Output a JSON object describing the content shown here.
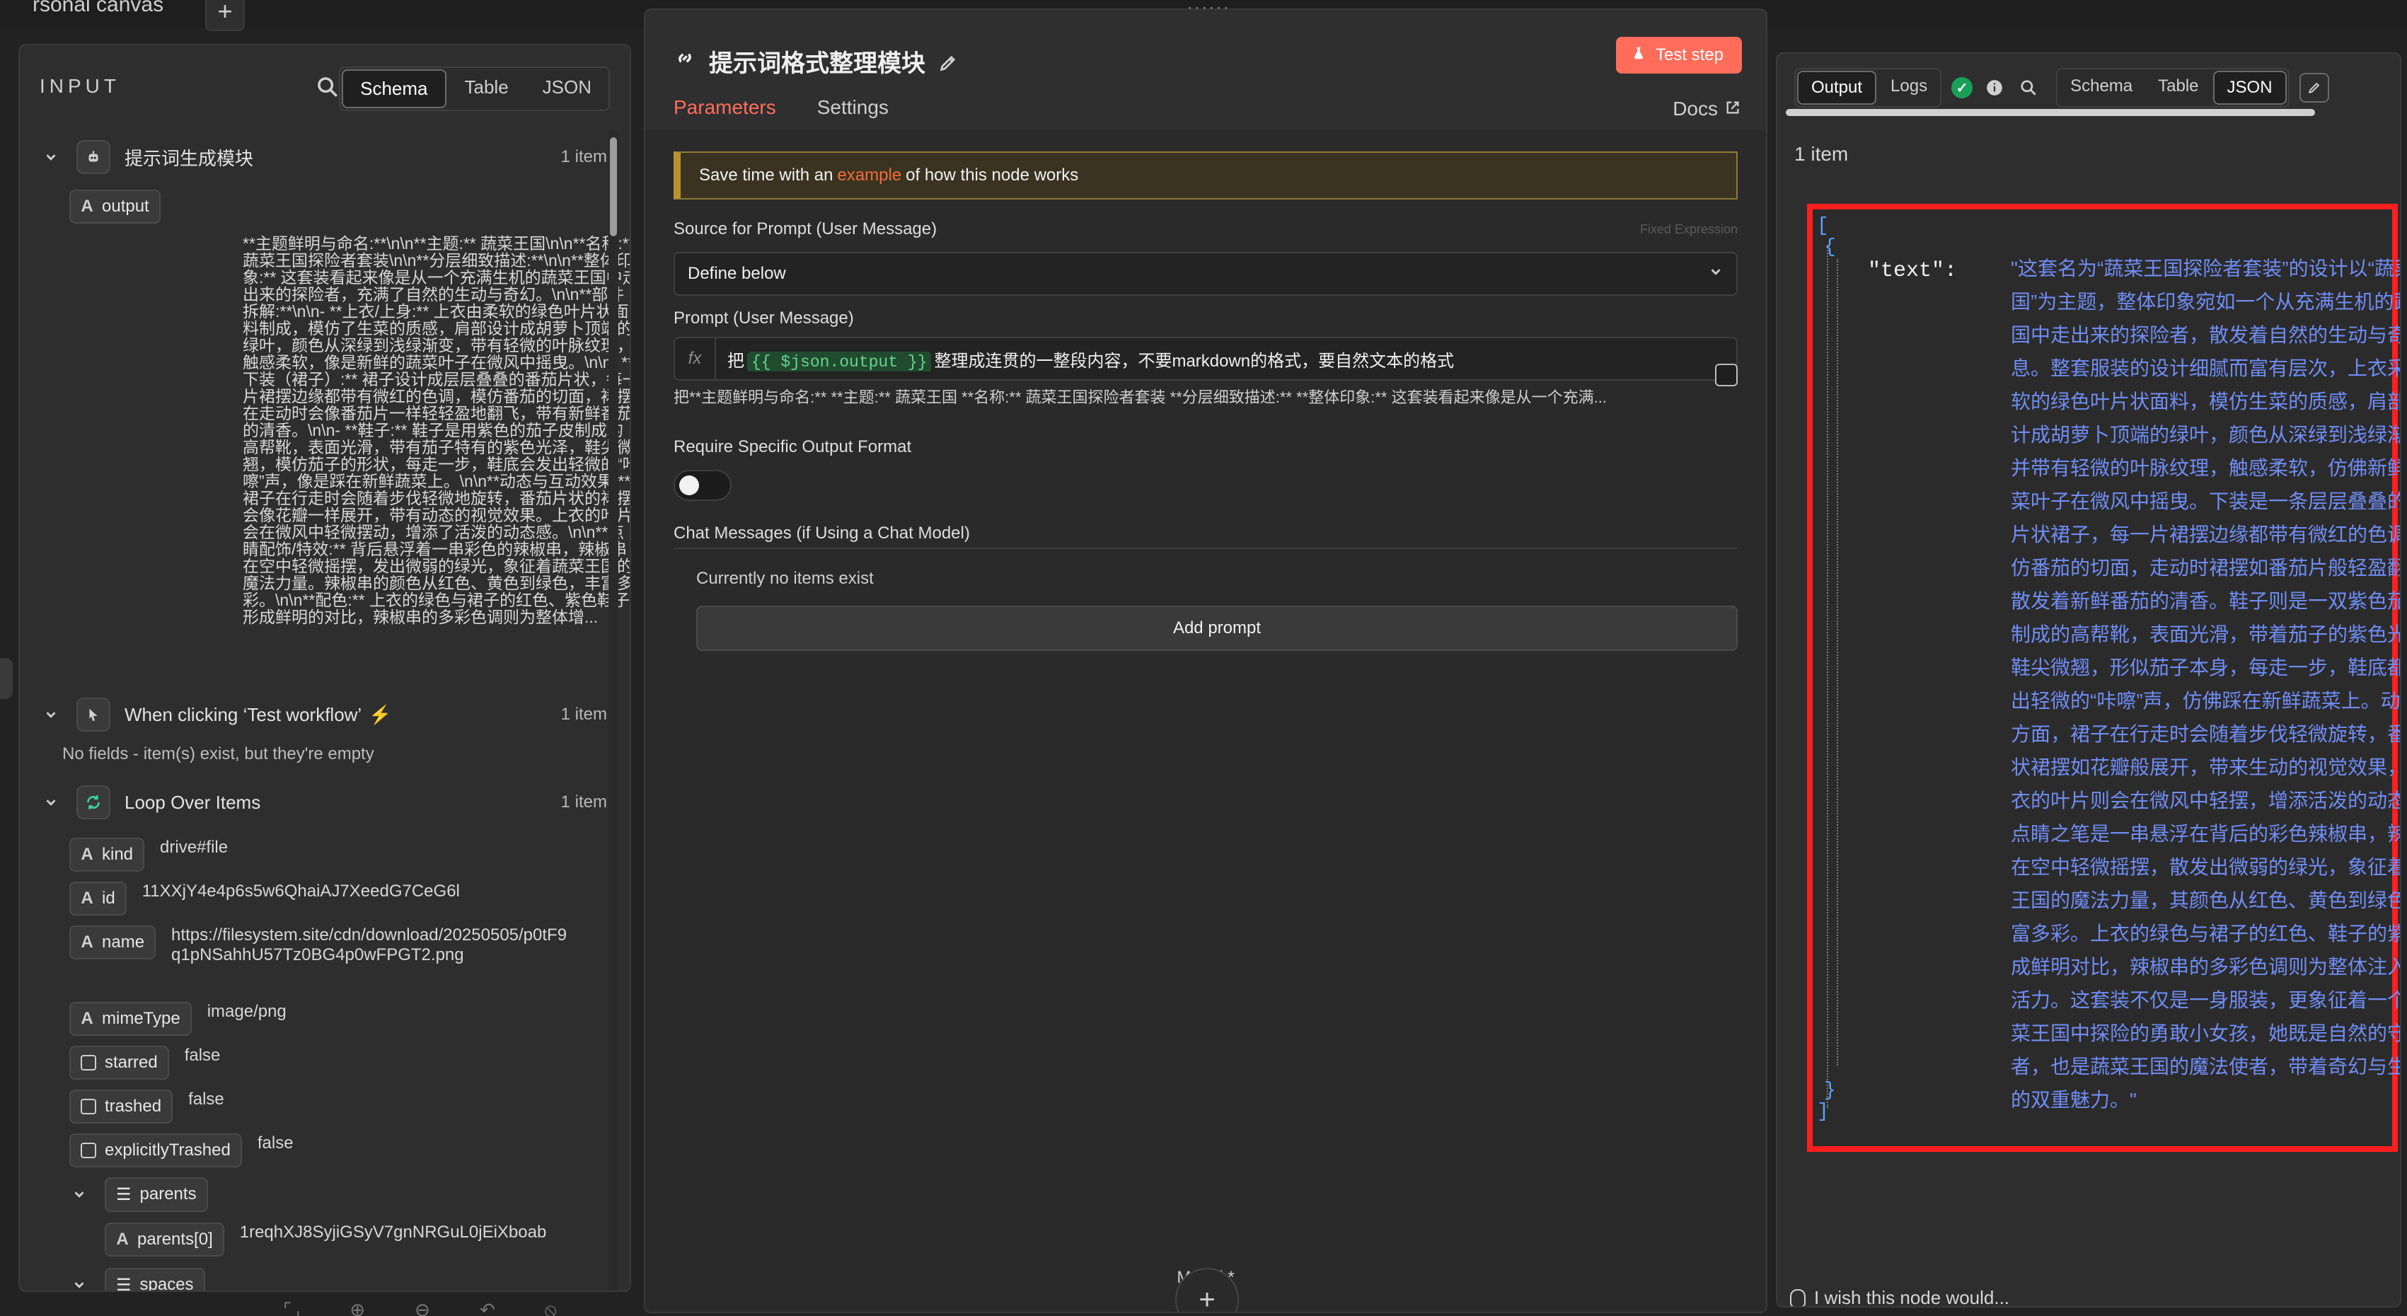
{
  "topbar": {
    "title": "rsonal canvas",
    "plus": "+",
    "grip": "::::::"
  },
  "input": {
    "header": "INPUT",
    "tabs": [
      "Schema",
      "Table",
      "JSON"
    ],
    "active_tab": "Schema",
    "nodes": [
      {
        "name": "提示词生成模块",
        "count": "1 item",
        "fields": [
          {
            "type": "A",
            "key": "output",
            "value": "**主题鲜明与命名:**\\n\\n**主题:** 蔬菜王国\\n\\n**名称:** 蔬菜王国探险者套装\\n\\n**分层细致描述:**\\n\\n**整体印象:** 这套装看起来像是从一个充满生机的蔬菜王国中走出来的探险者，充满了自然的生动与奇幻。\\n\\n**部件拆解:**\\n\\n- **上衣/上身:** 上衣由柔软的绿色叶片状面料制成，模仿了生菜的质感，肩部设计成胡萝卜顶端的绿叶，颜色从深绿到浅绿渐变，带有轻微的叶脉纹理，触感柔软，像是新鲜的蔬菜叶子在微风中摇曳。\\n\\n- **下装（裙子）:** 裙子设计成层层叠叠的番茄片状，每一片裙摆边缘都带有微红的色调，模仿番茄的切面，裙摆在走动时会像番茄片一样轻轻盈地翻飞，带有新鲜番茄的清香。\\n\\n- **鞋子:** 鞋子是用紫色的茄子皮制成的高帮靴，表面光滑，带有茄子特有的紫色光泽，鞋尖微翘，模仿茄子的形状，每走一步，鞋底会发出轻微的“咔嚓”声，像是踩在新鲜蔬菜上。\\n\\n**动态与互动效果:** 裙子在行走时会随着步伐轻微地旋转，番茄片状的裙摆会像花瓣一样展开，带有动态的视觉效果。上衣的叶片会在微风中轻微摆动，增添了活泼的动态感。\\n\\n**点睛配饰/特效:** 背后悬浮着一串彩色的辣椒串，辣椒串在空中轻微摇摆，发出微弱的绿光，象征着蔬菜王国的魔法力量。辣椒串的颜色从红色、黄色到绿色，丰富多彩。\\n\\n**配色:** 上衣的绿色与裙子的红色、紫色鞋子形成鲜明的对比，辣椒串的多彩色调则为整体增..."
          }
        ]
      },
      {
        "name": "When clicking ‘Test workflow’",
        "count": "1 item",
        "note": "No fields - item(s) exist, but they're empty"
      },
      {
        "name": "Loop Over Items",
        "count": "1 item",
        "fields": [
          {
            "type": "A",
            "key": "kind",
            "value": "drive#file"
          },
          {
            "type": "A",
            "key": "id",
            "value": "11XXjY4e4p6s5w6QhaiAJ7XeedG7CeG6l"
          },
          {
            "type": "A",
            "key": "name",
            "value": "https://filesystem.site/cdn/download/20250505/p0tF9q1pNSahhU57Tz0BG4p0wFPGT2.png"
          },
          {
            "type": "A",
            "key": "mimeType",
            "value": "image/png"
          },
          {
            "type": "bool",
            "key": "starred",
            "value": "false"
          },
          {
            "type": "bool",
            "key": "trashed",
            "value": "false"
          },
          {
            "type": "bool",
            "key": "explicitlyTrashed",
            "value": "false"
          },
          {
            "type": "list",
            "key": "parents",
            "value": ""
          },
          {
            "type": "A",
            "key": "parents[0]",
            "value": "1reqhXJ8SyjiGSyV7gnNRGuL0jEiXboab"
          },
          {
            "type": "list",
            "key": "spaces",
            "value": ""
          }
        ]
      }
    ]
  },
  "center": {
    "title": "提示词格式整理模块",
    "test_step": "Test step",
    "tabs": [
      "Parameters",
      "Settings"
    ],
    "active_tab": "Parameters",
    "docs": "Docs",
    "banner": {
      "prefix": "Save time with an",
      "link": "example",
      "suffix": "of how this node works"
    },
    "source_label": "Source for Prompt (User Message)",
    "source_value": "Define below",
    "fixed_expression": "Fixed  Expression",
    "prompt_label": "Prompt (User Message)",
    "prompt_value_prefix": "把",
    "prompt_expr": "{{ $json.output }}",
    "prompt_value_suffix": "整理成连贯的一整段内容，不要markdown的格式，要自然文本的格式",
    "prompt_preview": "把**主题鲜明与命名:** **主题:** 蔬菜王国 **名称:** 蔬菜王国探险者套装 **分层细致描述:** **整体印象:** 这套装看起来像是从一个充满...",
    "require_label": "Require Specific Output Format",
    "chat_label": "Chat Messages (if Using a Chat Model)",
    "no_items": "Currently no items exist",
    "add_prompt": "Add prompt",
    "model_label": "Model *"
  },
  "output": {
    "tabs": [
      "Output",
      "Logs"
    ],
    "active_tab": "Output",
    "view_tabs": [
      "Schema",
      "Table",
      "JSON"
    ],
    "active_view": "JSON",
    "items": "1 item",
    "json_key": "\"text\":",
    "json_text": "\"这套名为“蔬菜王国探险者套装”的设计以“蔬菜王国”为主题，整体印象宛如一个从充满生机的蔬菜王国中走出来的探险者，散发着自然的生动与奇幻气息。整套服装的设计细腻而富有层次，上衣采用柔软的绿色叶片状面料，模仿生菜的质感，肩部则设计成胡萝卜顶端的绿叶，颜色从深绿到浅绿渐变，并带有轻微的叶脉纹理，触感柔软，仿佛新鲜的蔬菜叶子在微风中摇曳。下装是一条层层叠叠的番茄片状裙子，每一片裙摆边缘都带有微红的色调，模仿番茄的切面，走动时裙摆如番茄片般轻盈翻飞，散发着新鲜番茄的清香。鞋子则是一双紫色茄子皮制成的高帮靴，表面光滑，带着茄子的紫色光泽，鞋尖微翘，形似茄子本身，每走一步，鞋底都会发出轻微的“咔嚓”声，仿佛踩在新鲜蔬菜上。动态效果方面，裙子在行走时会随着步伐轻微旋转，番茄片状裙摆如花瓣般展开，带来生动的视觉效果，而上衣的叶片则会在微风中轻摆，增添活泼的动态感。点睛之笔是一串悬浮在背后的彩色辣椒串，辣椒串在空中轻微摇摆，散发出微弱的绿光，象征着蔬菜王国的魔法力量，其颜色从红色、黄色到绿色，丰富多彩。上衣的绿色与裙子的红色、鞋子的紫色形成鲜明对比，辣椒串的多彩色调则为整体注入更多活力。这套装不仅是一身服装，更象征着一个在蔬菜王国中探险的勇敢小女孩，她既是自然的守护者，也是蔬菜王国的魔法使者，带着奇幻与生命力的双重魅力。\"",
    "bottom_text": "I wish this node would..."
  }
}
